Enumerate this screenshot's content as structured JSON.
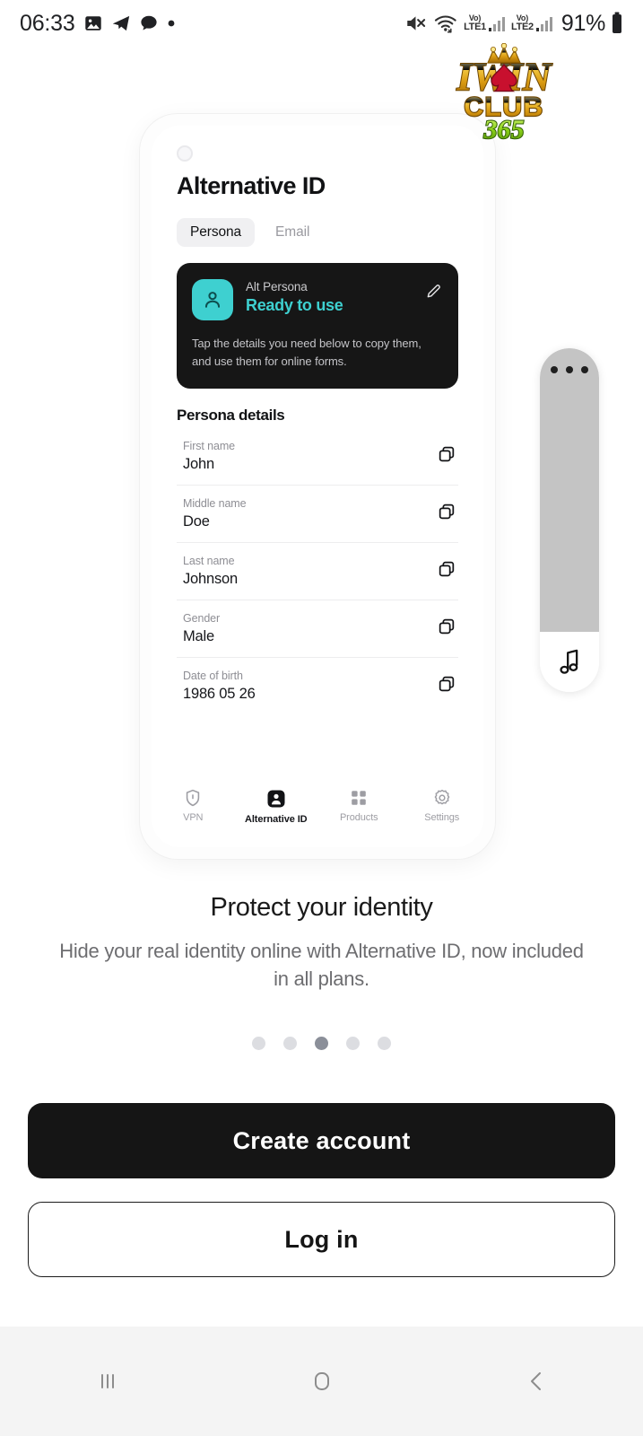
{
  "status_bar": {
    "time": "06:33",
    "battery_percent": "91%",
    "icons": [
      "photos-icon",
      "telegram-icon",
      "chat-bubble-icon",
      "dot-icon",
      "mute-icon",
      "wifi-icon"
    ],
    "sim1": {
      "volte": "Vo)",
      "network": "LTE1"
    },
    "sim2": {
      "volte": "Vo)",
      "network": "LTE2"
    }
  },
  "brand_logo": {
    "line1": "IWIN",
    "line2": "CLUB",
    "line3": "365",
    "gold": "#f5c518",
    "green": "#7ed321",
    "red": "#cc1122"
  },
  "phone_mock": {
    "app_title": "Alternative ID",
    "tabs": [
      {
        "label": "Persona",
        "active": true
      },
      {
        "label": "Email",
        "active": false
      }
    ],
    "persona_card": {
      "avatar_icon": "person-icon",
      "avatar_color": "#3ed0d0",
      "label": "Alt Persona",
      "status": "Ready to use",
      "status_color": "#3ed0d0",
      "edit_icon": "pencil-icon",
      "description": "Tap the details you need below to copy them, and use them for online forms."
    },
    "details_heading": "Persona details",
    "details": [
      {
        "key": "First name",
        "value": "John",
        "copy_icon": "copy-icon"
      },
      {
        "key": "Middle name",
        "value": "Doe",
        "copy_icon": "copy-icon"
      },
      {
        "key": "Last name",
        "value": "Johnson",
        "copy_icon": "copy-icon"
      },
      {
        "key": "Gender",
        "value": "Male",
        "copy_icon": "copy-icon"
      },
      {
        "key": "Date of birth",
        "value": "1986 05 26",
        "copy_icon": "copy-icon"
      }
    ],
    "bottom_nav": [
      {
        "label": "VPN",
        "icon": "shield-icon",
        "active": false
      },
      {
        "label": "Alternative ID",
        "icon": "id-badge-icon",
        "active": true
      },
      {
        "label": "Products",
        "icon": "grid-icon",
        "active": false
      },
      {
        "label": "Settings",
        "icon": "gear-icon",
        "active": false
      }
    ]
  },
  "floating_widget": {
    "menu_icon": "three-dots-icon",
    "footer_icon": "music-note-icon"
  },
  "promo": {
    "heading": "Protect your identity",
    "body": "Hide your real identity online with Alternative ID, now included in all plans."
  },
  "pager": {
    "total": 5,
    "active_index": 2
  },
  "cta": {
    "primary_label": "Create account",
    "secondary_label": "Log in"
  },
  "android_nav": {
    "recents_icon": "recents-icon",
    "home_icon": "home-icon",
    "back_icon": "back-icon"
  }
}
